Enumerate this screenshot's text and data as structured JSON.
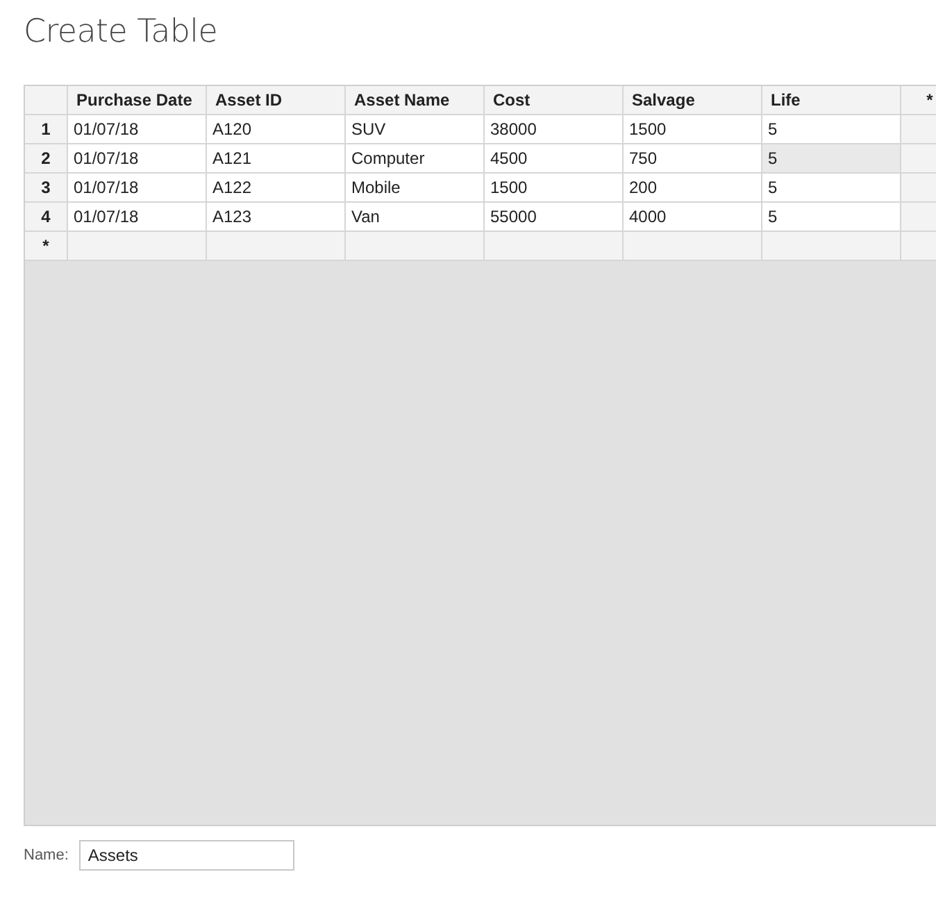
{
  "title": "Create Table",
  "table": {
    "columns": [
      "Purchase Date",
      "Asset ID",
      "Asset Name",
      "Cost",
      "Salvage",
      "Life"
    ],
    "add_column_marker": "*",
    "rows": [
      {
        "number": "1",
        "cells": [
          {
            "text": "01/07/18",
            "selected": false
          },
          {
            "text": "A120",
            "selected": false
          },
          {
            "text": "SUV",
            "selected": false
          },
          {
            "text": "38000",
            "selected": false
          },
          {
            "text": "1500",
            "selected": false
          },
          {
            "text": "5",
            "selected": false
          }
        ]
      },
      {
        "number": "2",
        "cells": [
          {
            "text": "01/07/18",
            "selected": false
          },
          {
            "text": "A121",
            "selected": false
          },
          {
            "text": "Computer",
            "selected": false
          },
          {
            "text": "4500",
            "selected": false
          },
          {
            "text": "750",
            "selected": false
          },
          {
            "text": "5",
            "selected": true
          }
        ]
      },
      {
        "number": "3",
        "cells": [
          {
            "text": "01/07/18",
            "selected": false
          },
          {
            "text": "A122",
            "selected": false
          },
          {
            "text": "Mobile",
            "selected": false
          },
          {
            "text": "1500",
            "selected": false
          },
          {
            "text": "200",
            "selected": false
          },
          {
            "text": "5",
            "selected": false
          }
        ]
      },
      {
        "number": "4",
        "cells": [
          {
            "text": "01/07/18",
            "selected": false
          },
          {
            "text": "A123",
            "selected": false
          },
          {
            "text": "Van",
            "selected": false
          },
          {
            "text": "55000",
            "selected": false
          },
          {
            "text": "4000",
            "selected": false
          },
          {
            "text": "5",
            "selected": false
          }
        ]
      }
    ],
    "new_row_marker": "*"
  },
  "name_field": {
    "label": "Name:",
    "value": "Assets"
  }
}
